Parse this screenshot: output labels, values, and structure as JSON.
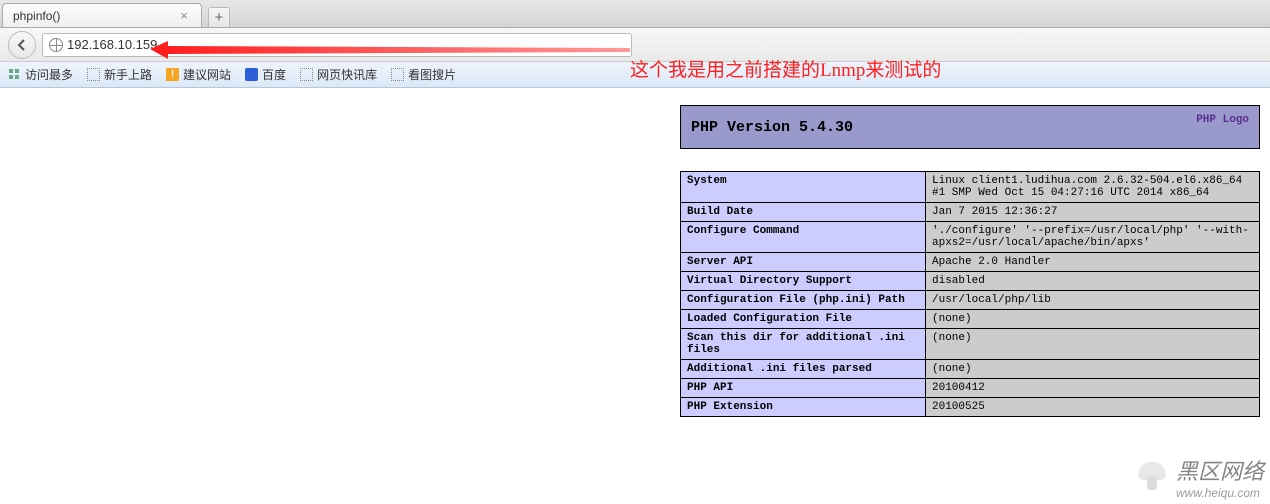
{
  "tab": {
    "title": "phpinfo()"
  },
  "address": {
    "url": "192.168.10.159"
  },
  "annotation": "这个我是用之前搭建的Lnmp来测试的",
  "bookmarks": {
    "most_visited": "访问最多",
    "getting_started": "新手上路",
    "suggested": "建议网站",
    "baidu": "百度",
    "news": "网页快讯库",
    "image_search": "看图搜片"
  },
  "php": {
    "version_label": "PHP Version 5.4.30",
    "logo_text": "PHP Logo",
    "rows": [
      {
        "k": "System",
        "v": "Linux client1.ludihua.com 2.6.32-504.el6.x86_64 #1 SMP Wed Oct 15 04:27:16 UTC 2014 x86_64"
      },
      {
        "k": "Build Date",
        "v": "Jan 7 2015 12:36:27"
      },
      {
        "k": "Configure Command",
        "v": "'./configure' '--prefix=/usr/local/php' '--with-apxs2=/usr/local/apache/bin/apxs'"
      },
      {
        "k": "Server API",
        "v": "Apache 2.0 Handler"
      },
      {
        "k": "Virtual Directory Support",
        "v": "disabled"
      },
      {
        "k": "Configuration File (php.ini) Path",
        "v": "/usr/local/php/lib"
      },
      {
        "k": "Loaded Configuration File",
        "v": "(none)"
      },
      {
        "k": "Scan this dir for additional .ini files",
        "v": "(none)"
      },
      {
        "k": "Additional .ini files parsed",
        "v": "(none)"
      },
      {
        "k": "PHP API",
        "v": "20100412"
      },
      {
        "k": "PHP Extension",
        "v": "20100525"
      }
    ]
  },
  "watermark": {
    "brand": "黑区网络",
    "url": "www.heiqu.com"
  }
}
